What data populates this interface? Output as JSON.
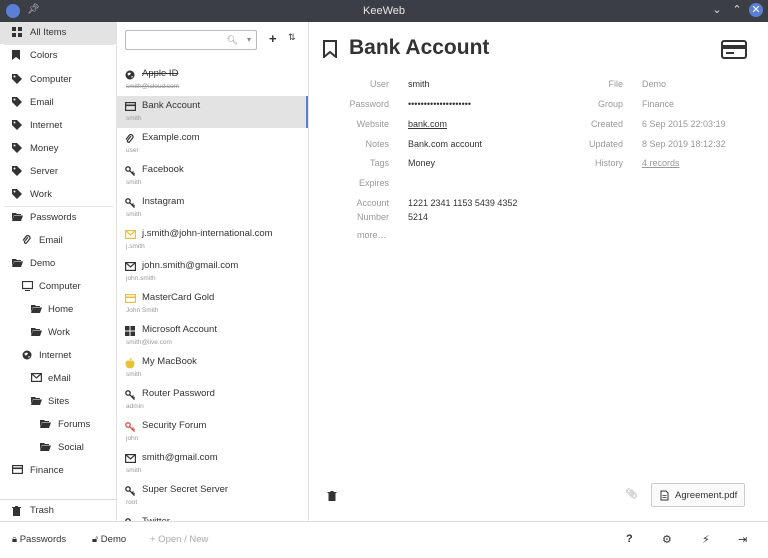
{
  "window": {
    "title": "KeeWeb"
  },
  "menu": {
    "items": [
      {
        "label": "All Items",
        "icon": "grid-icon"
      },
      {
        "label": "Colors",
        "icon": "bookmark-icon"
      },
      {
        "label": "Computer",
        "icon": "tag-icon"
      },
      {
        "label": "Email",
        "icon": "tag-icon"
      },
      {
        "label": "Internet",
        "icon": "tag-icon"
      },
      {
        "label": "Money",
        "icon": "tag-icon"
      },
      {
        "label": "Server",
        "icon": "tag-icon"
      },
      {
        "label": "Work",
        "icon": "tag-icon"
      },
      {
        "label": "Passwords",
        "icon": "folder-open-icon"
      },
      {
        "label": "Email",
        "icon": "paperclip-icon"
      },
      {
        "label": "Demo",
        "icon": "folder-open-icon"
      },
      {
        "label": "Computer",
        "icon": "monitor-icon"
      },
      {
        "label": "Home",
        "icon": "folder-open-icon"
      },
      {
        "label": "Work",
        "icon": "folder-open-icon"
      },
      {
        "label": "Internet",
        "icon": "globe-icon"
      },
      {
        "label": "eMail",
        "icon": "envelope-icon"
      },
      {
        "label": "Sites",
        "icon": "folder-open-icon"
      },
      {
        "label": "Forums",
        "icon": "folder-open-icon"
      },
      {
        "label": "Social",
        "icon": "folder-open-icon"
      },
      {
        "label": "Finance",
        "icon": "credit-card-icon"
      }
    ],
    "trash": "Trash"
  },
  "list": {
    "search_value": "",
    "entries": [
      {
        "title": "Apple ID",
        "sub": "smith@icloud.com",
        "icon": "globe-icon",
        "expired": true
      },
      {
        "title": "Bank Account",
        "sub": "smith",
        "icon": "credit-card-icon",
        "selected": true
      },
      {
        "title": "Example.com",
        "sub": "user",
        "icon": "paperclip-icon"
      },
      {
        "title": "Facebook",
        "sub": "smith",
        "icon": "key-icon"
      },
      {
        "title": "Instagram",
        "sub": "smith",
        "icon": "key-icon"
      },
      {
        "title": "j.smith@john-international.com",
        "sub": "j.smith",
        "icon": "envelope-icon",
        "color": "#e8c33a"
      },
      {
        "title": "john.smith@gmail.com",
        "sub": "john.smith",
        "icon": "envelope-icon"
      },
      {
        "title": "MasterCard Gold",
        "sub": "John Smith",
        "icon": "credit-card-icon",
        "color": "#e8c33a"
      },
      {
        "title": "Microsoft Account",
        "sub": "smith@live.com",
        "icon": "windows-icon"
      },
      {
        "title": "My MacBook",
        "sub": "smith",
        "icon": "apple-icon",
        "color": "#e8c33a"
      },
      {
        "title": "Router Password",
        "sub": "admin",
        "icon": "key-icon"
      },
      {
        "title": "Security Forum",
        "sub": "john",
        "icon": "key-icon",
        "color": "#d9534f"
      },
      {
        "title": "smith@gmail.com",
        "sub": "smith",
        "icon": "envelope-icon"
      },
      {
        "title": "Super Secret Server",
        "sub": "root",
        "icon": "key-icon"
      },
      {
        "title": "Twitter",
        "sub": "",
        "icon": "key-icon"
      }
    ]
  },
  "detail": {
    "title": "Bank Account",
    "left_fields": [
      {
        "label": "User",
        "value": "smith"
      },
      {
        "label": "Password",
        "value": "••••••••••••••••••••"
      },
      {
        "label": "Website",
        "value": "bank.com",
        "link": true
      },
      {
        "label": "Notes",
        "value": "Bank.com account"
      },
      {
        "label": "Tags",
        "value": "Money"
      },
      {
        "label": "Expires",
        "value": ""
      },
      {
        "label": "Account",
        "value": "1221 2341 1153 5439 4352"
      },
      {
        "label": "Number",
        "value": "5214"
      }
    ],
    "right_fields": [
      {
        "label": "File",
        "value": "Demo"
      },
      {
        "label": "Group",
        "value": "Finance"
      },
      {
        "label": "Created",
        "value": "6 Sep 2015 22:03:19"
      },
      {
        "label": "Updated",
        "value": "8 Sep 2019 18:12:32"
      },
      {
        "label": "History",
        "value": "4 records",
        "link": true
      }
    ],
    "more": "more…",
    "attachment": "Agreement.pdf"
  },
  "footer": {
    "passwords": "Passwords",
    "demo": "Demo",
    "open_new": "+ Open / New"
  },
  "colors": {
    "accent": "#5b7fd6",
    "titlebar": "#3b3f45"
  }
}
